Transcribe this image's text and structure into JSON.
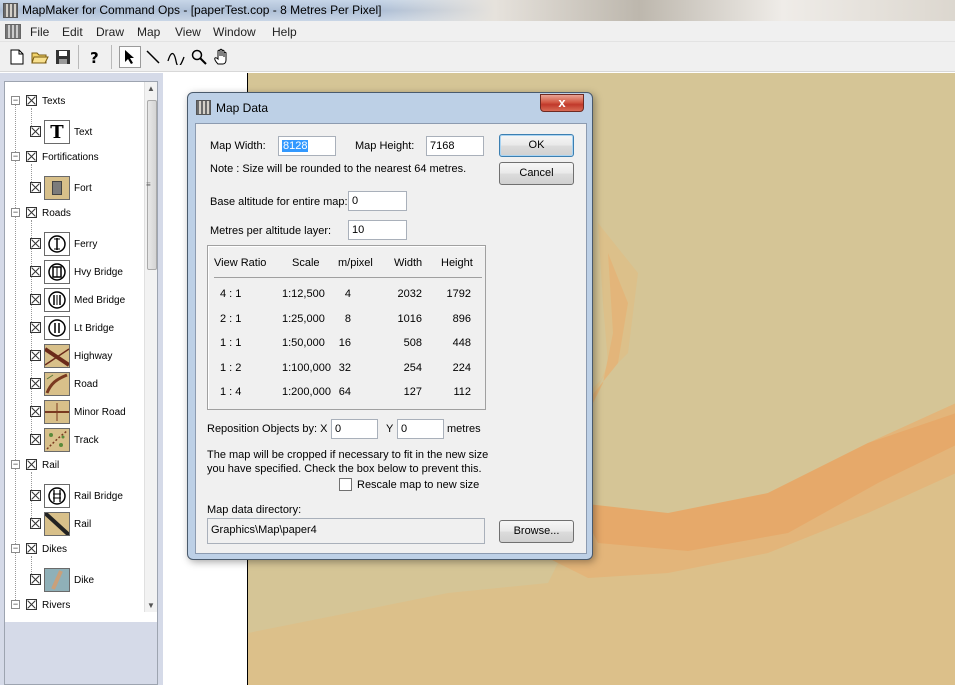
{
  "window": {
    "title": "MapMaker for Command Ops - [paperTest.cop - 8 Metres Per Pixel]"
  },
  "menu": [
    "File",
    "Edit",
    "Draw",
    "Map",
    "View",
    "Window",
    "Help"
  ],
  "palette": {
    "categories": [
      {
        "label": "Texts",
        "items": [
          {
            "label": "Text",
            "icon": "text-T-icon"
          }
        ]
      },
      {
        "label": "Fortifications",
        "items": [
          {
            "label": "Fort",
            "icon": "fort-icon"
          }
        ]
      },
      {
        "label": "Roads",
        "items": [
          {
            "label": "Ferry",
            "icon": "ferry-icon"
          },
          {
            "label": "Hvy Bridge",
            "icon": "heavy-bridge-icon"
          },
          {
            "label": "Med Bridge",
            "icon": "medium-bridge-icon"
          },
          {
            "label": "Lt Bridge",
            "icon": "light-bridge-icon"
          },
          {
            "label": "Highway",
            "icon": "highway-icon"
          },
          {
            "label": "Road",
            "icon": "road-icon"
          },
          {
            "label": "Minor Road",
            "icon": "minor-road-icon"
          },
          {
            "label": "Track",
            "icon": "track-icon"
          }
        ]
      },
      {
        "label": "Rail",
        "items": [
          {
            "label": "Rail Bridge",
            "icon": "rail-bridge-icon"
          },
          {
            "label": "Rail",
            "icon": "rail-icon"
          }
        ]
      },
      {
        "label": "Dikes",
        "items": [
          {
            "label": "Dike",
            "icon": "dike-icon"
          }
        ]
      },
      {
        "label": "Rivers",
        "items": []
      }
    ]
  },
  "dialog": {
    "title": "Map Data",
    "map_width_label": "Map Width:",
    "map_width_value": "8128",
    "map_height_label": "Map Height:",
    "map_height_value": "7168",
    "note": "Note : Size will be rounded to the nearest 64 metres.",
    "base_altitude_label": "Base altitude for entire map:",
    "base_altitude_value": "0",
    "metres_per_layer_label": "Metres per altitude layer:",
    "metres_per_layer_value": "10",
    "table": {
      "headers": [
        "View Ratio",
        "Scale",
        "m/pixel",
        "Width",
        "Height"
      ],
      "rows": [
        [
          "4 : 1",
          "1:12,500",
          "4",
          "2032",
          "1792"
        ],
        [
          "2 : 1",
          "1:25,000",
          "8",
          "1016",
          "896"
        ],
        [
          "1 : 1",
          "1:50,000",
          "16",
          "508",
          "448"
        ],
        [
          "1 : 2",
          "1:100,000",
          "32",
          "254",
          "224"
        ],
        [
          "1 : 4",
          "1:200,000",
          "64",
          "127",
          "112"
        ]
      ]
    },
    "reposition_label": "Reposition Objects by: X",
    "reposition_x": "0",
    "reposition_y_label": "Y",
    "reposition_y": "0",
    "reposition_units": "metres",
    "crop_note_1": "The map will be cropped if necessary to fit in the new size",
    "crop_note_2": "you have specified.  Check the box below to prevent this.",
    "rescale_label": "Rescale map to new size",
    "rescale_checked": false,
    "dir_label": "Map data directory:",
    "dir_value": "Graphics\\Map\\paper4",
    "ok_label": "OK",
    "cancel_label": "Cancel",
    "browse_label": "Browse...",
    "close_glyph": "x"
  },
  "colors": {
    "map_base": "#d5c596",
    "terrain_1": "#dcc08a",
    "terrain_2": "#e3b57a",
    "terrain_3": "#e6a96a",
    "dialog_frame": "#bdd0e6"
  }
}
